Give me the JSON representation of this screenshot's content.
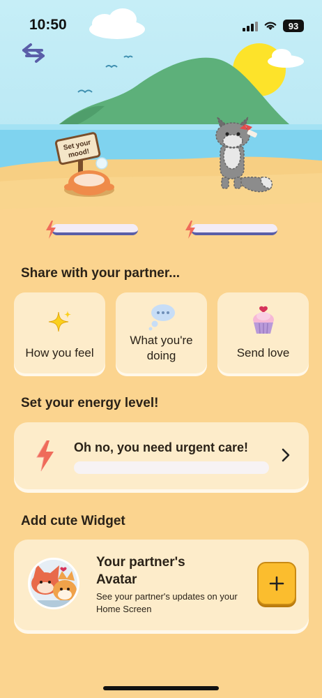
{
  "status_bar": {
    "time": "10:50",
    "battery": "93"
  },
  "scene": {
    "sign_text_line1": "Set your",
    "sign_text_line2": "mood!"
  },
  "share": {
    "title": "Share with your partner...",
    "cards": [
      {
        "label": "How you feel",
        "icon": "sparkle-icon"
      },
      {
        "label": "What you're doing",
        "icon": "thought-bubble-icon"
      },
      {
        "label": "Send love",
        "icon": "cupcake-icon"
      }
    ]
  },
  "energy": {
    "title": "Set your energy level!",
    "status": "Oh no, you need urgent care!",
    "level": 0
  },
  "widget": {
    "title": "Add cute Widget",
    "card_title": "Your partner's Avatar",
    "card_subtitle": "See your partner's updates on your Home Screen",
    "add_label": "+"
  },
  "colors": {
    "accent": "#fbbd2e",
    "background": "#fbd48f",
    "card": "#fdecca",
    "bolt": "#ef6b5a",
    "bar_edge": "#5a5ea8"
  }
}
